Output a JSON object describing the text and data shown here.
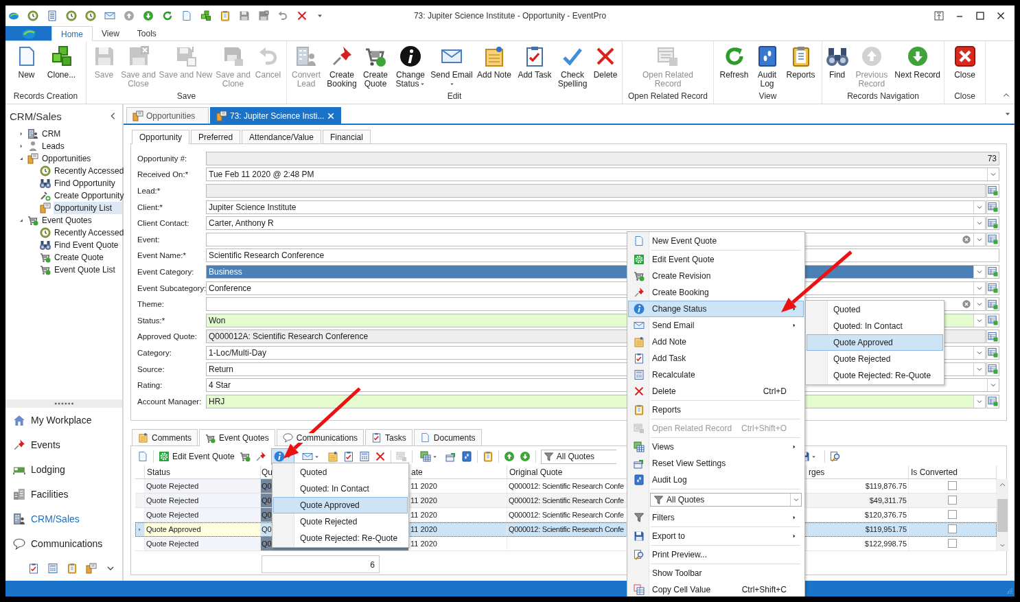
{
  "window": {
    "title": "73: Jupiter Science Institute - Opportunity - EventPro"
  },
  "ribbon": {
    "tabs": [
      {
        "label": "Home",
        "selected": true
      },
      {
        "label": "View",
        "selected": false
      },
      {
        "label": "Tools",
        "selected": false
      }
    ],
    "groups": [
      {
        "label": "Records Creation",
        "buttons": [
          {
            "label": "New",
            "disabled": false,
            "dropdown": false
          },
          {
            "label": "Clone...",
            "disabled": false,
            "dropdown": false
          }
        ]
      },
      {
        "label": "Save",
        "buttons": [
          {
            "label": "Save",
            "disabled": true,
            "dropdown": false
          },
          {
            "label": "Save and Close",
            "disabled": true,
            "dropdown": false
          },
          {
            "label": "Save and New",
            "disabled": true,
            "dropdown": false
          },
          {
            "label": "Save and Clone",
            "disabled": true,
            "dropdown": false
          },
          {
            "label": "Cancel",
            "disabled": true,
            "dropdown": false
          }
        ]
      },
      {
        "label": "Edit",
        "buttons": [
          {
            "label": "Convert Lead",
            "disabled": true,
            "dropdown": false
          },
          {
            "label": "Create Booking",
            "disabled": false,
            "dropdown": false
          },
          {
            "label": "Create Quote",
            "disabled": false,
            "dropdown": false
          },
          {
            "label": "Change Status",
            "disabled": false,
            "dropdown": true
          },
          {
            "label": "Send Email",
            "disabled": false,
            "dropdown": true
          },
          {
            "label": "Add Note",
            "disabled": false,
            "dropdown": false
          },
          {
            "label": "Add Task",
            "disabled": false,
            "dropdown": false
          },
          {
            "label": "Check Spelling",
            "disabled": false,
            "dropdown": false
          },
          {
            "label": "Delete",
            "disabled": false,
            "dropdown": false
          }
        ]
      },
      {
        "label": "Open Related Record",
        "buttons": [
          {
            "label": "Open Related Record",
            "disabled": true,
            "dropdown": false
          }
        ]
      },
      {
        "label": "View",
        "buttons": [
          {
            "label": "Refresh",
            "disabled": false,
            "dropdown": false
          },
          {
            "label": "Audit Log",
            "disabled": false,
            "dropdown": false
          },
          {
            "label": "Reports",
            "disabled": false,
            "dropdown": false
          }
        ]
      },
      {
        "label": "Records Navigation",
        "buttons": [
          {
            "label": "Find",
            "disabled": false,
            "dropdown": false
          },
          {
            "label": "Previous Record",
            "disabled": true,
            "dropdown": false
          },
          {
            "label": "Next Record",
            "disabled": false,
            "dropdown": false
          }
        ]
      },
      {
        "label": "Close",
        "buttons": [
          {
            "label": "Close",
            "disabled": false,
            "dropdown": false
          }
        ]
      }
    ]
  },
  "sidebar": {
    "title": "CRM/Sales",
    "tree": [
      {
        "label": "CRM",
        "expanded": false,
        "selected": false
      },
      {
        "label": "Leads",
        "expanded": false,
        "selected": false
      },
      {
        "label": "Opportunities",
        "expanded": true,
        "selected": false,
        "children": [
          {
            "label": "Recently Accessed",
            "selected": false
          },
          {
            "label": "Find Opportunity",
            "selected": false
          },
          {
            "label": "Create Opportunity",
            "selected": false
          },
          {
            "label": "Opportunity List",
            "selected": true
          }
        ]
      },
      {
        "label": "Event Quotes",
        "expanded": true,
        "selected": false,
        "children": [
          {
            "label": "Recently Accessed",
            "selected": false
          },
          {
            "label": "Find Event Quote",
            "selected": false
          },
          {
            "label": "Create Quote",
            "selected": false
          },
          {
            "label": "Event Quote List",
            "selected": false
          }
        ]
      }
    ],
    "nav": [
      {
        "label": "My Workplace",
        "selected": false
      },
      {
        "label": "Events",
        "selected": false
      },
      {
        "label": "Lodging",
        "selected": false
      },
      {
        "label": "Facilities",
        "selected": false
      },
      {
        "label": "CRM/Sales",
        "selected": true
      },
      {
        "label": "Communications",
        "selected": false
      }
    ]
  },
  "document_tabs": [
    {
      "label": "Opportunities",
      "selected": false,
      "closable": false
    },
    {
      "label": "73: Jupiter Science Insti...",
      "selected": true,
      "closable": true
    }
  ],
  "form": {
    "tabs": [
      {
        "label": "Opportunity",
        "selected": true
      },
      {
        "label": "Preferred",
        "selected": false
      },
      {
        "label": "Attendance/Value",
        "selected": false
      },
      {
        "label": "Financial",
        "selected": false
      }
    ],
    "fields": [
      {
        "label": "Opportunity #:",
        "value": "73",
        "kind": "number",
        "readonly": true
      },
      {
        "label": "Received On:*",
        "value": "Tue Feb 11 2020 @ 2:48 PM",
        "kind": "text",
        "dropdown": true
      },
      {
        "label": "Lead:*",
        "readonly": true,
        "lookup": true
      },
      {
        "label": "Client:*",
        "value": "Jupiter Science Institute",
        "kind": "text",
        "dropdown": true,
        "lookup": true
      },
      {
        "label": "Client Contact:",
        "value": "Carter, Anthony R",
        "kind": "text",
        "dropdown": true,
        "lookup": true
      },
      {
        "label": "Event:",
        "clear": true,
        "dropdown": true,
        "lookup": true
      },
      {
        "label": "Event Name:*",
        "value": "Scientific Research Conference",
        "kind": "text"
      },
      {
        "label": "Event Category:",
        "value": "Business",
        "kind": "text",
        "highlighted": true,
        "dropdown": true,
        "lookup": true
      },
      {
        "label": "Event Subcategory:",
        "value": "Conference",
        "kind": "text",
        "dropdown": true,
        "lookup": true
      },
      {
        "label": "Theme:",
        "clear": true,
        "dropdown": true,
        "lookup": true
      },
      {
        "label": "Status:*",
        "value": "Won",
        "kind": "text",
        "valid": true,
        "dropdown": true,
        "lookup": true
      },
      {
        "label": "Approved Quote:",
        "value": "Q000012A: Scientific Research Conference",
        "kind": "text",
        "readonly": true,
        "lookup": true
      },
      {
        "label": "Category:",
        "value": "1-Loc/Multi-Day",
        "kind": "text",
        "dropdown": true,
        "lookup": true
      },
      {
        "label": "Source:",
        "value": "Return",
        "kind": "text",
        "dropdown": true,
        "lookup": true
      },
      {
        "label": "Rating:",
        "value": "4 Star",
        "kind": "text",
        "dropdown": true
      },
      {
        "label": "Account Manager:",
        "value": "HRJ",
        "kind": "text",
        "valid": true,
        "dropdown": true,
        "lookup": true
      }
    ]
  },
  "details": {
    "tabs": [
      {
        "label": "Comments",
        "selected": false
      },
      {
        "label": "Event Quotes",
        "selected": true
      },
      {
        "label": "Communications",
        "selected": false
      },
      {
        "label": "Tasks",
        "selected": false
      },
      {
        "label": "Documents",
        "selected": false
      }
    ],
    "toolbar": {
      "edit_label": "Edit Event Quote",
      "filter": "All Quotes",
      "status_menu_open": true,
      "status_menu": [
        {
          "label": "Quoted",
          "selected": false
        },
        {
          "label": "Quoted: In Contact",
          "selected": false
        },
        {
          "label": "Quote Approved",
          "selected": true
        },
        {
          "label": "Quote Rejected",
          "selected": false
        },
        {
          "label": "Quote Rejected: Re-Quote",
          "selected": false
        }
      ]
    },
    "columns": [
      "Status",
      "Qu",
      "ate",
      "Original Quote",
      "rges",
      "Is Converted"
    ],
    "rows": [
      {
        "status": "Quote Rejected",
        "quote": "Q0",
        "date": "11 2020",
        "original_quote": "Q000012: Scientific Research Confe",
        "charges": "$119,876.75",
        "is_converted": false,
        "selected": false
      },
      {
        "status": "Quote Rejected",
        "quote": "Q0",
        "date": "11 2020",
        "original_quote": "Q000012: Scientific Research Confe",
        "charges": "$49,311.75",
        "is_converted": false,
        "selected": false
      },
      {
        "status": "Quote Rejected",
        "quote": "Q0",
        "date": "11 2020",
        "original_quote": "Q000012: Scientific Research Confe",
        "charges": "$120,376.75",
        "is_converted": false,
        "selected": false
      },
      {
        "status": "Quote Approved",
        "quote": "Q0",
        "date": "11 2020",
        "original_quote": "Q000012: Scientific Research Confe",
        "charges": "$119,951.75",
        "is_converted": false,
        "selected": true
      },
      {
        "status": "Quote Rejected",
        "quote": "Q0",
        "date": "11 2020",
        "charges": "$122,998.75",
        "is_converted": false,
        "selected": false
      }
    ],
    "summary": "6"
  },
  "context_menu": {
    "items": [
      {
        "kind": "item",
        "label": "New Event Quote",
        "selected": false
      },
      {
        "kind": "item",
        "label": "Edit Event Quote",
        "separator": true,
        "selected": false
      },
      {
        "kind": "item",
        "label": "Create Revision",
        "selected": false
      },
      {
        "kind": "item",
        "label": "Create Booking",
        "selected": false
      },
      {
        "kind": "item",
        "label": "Change Status",
        "submenu": true,
        "selected": true
      },
      {
        "kind": "item",
        "label": "Send Email",
        "submenu": true,
        "selected": false
      },
      {
        "kind": "item",
        "label": "Add Note",
        "selected": false
      },
      {
        "kind": "item",
        "label": "Add Task",
        "selected": false
      },
      {
        "kind": "item",
        "label": "Recalculate",
        "selected": false
      },
      {
        "kind": "item",
        "label": "Delete",
        "shortcut": "Ctrl+D",
        "selected": false
      },
      {
        "kind": "item",
        "label": "Reports",
        "separator": true,
        "selected": false
      },
      {
        "kind": "item",
        "label": "Open Related Record",
        "shortcut": "Ctrl+Shift+O",
        "separator": true,
        "disabled": true,
        "selected": false
      },
      {
        "kind": "item",
        "label": "Views",
        "separator": true,
        "submenu": true,
        "selected": false
      },
      {
        "kind": "item",
        "label": "Reset View Settings",
        "selected": false
      },
      {
        "kind": "item",
        "label": "Audit Log",
        "selected": false
      },
      {
        "kind": "combo",
        "label": "All Quotes",
        "separator": true
      },
      {
        "kind": "item",
        "label": "Filters",
        "submenu": true,
        "selected": false
      },
      {
        "kind": "item",
        "label": "Export to",
        "separator": true,
        "submenu": true,
        "selected": false
      },
      {
        "kind": "item",
        "label": "Print Preview...",
        "separator": true,
        "selected": false
      },
      {
        "kind": "item",
        "label": "Show Toolbar",
        "separator": true,
        "selected": false
      },
      {
        "kind": "item",
        "label": "Copy Cell Value",
        "shortcut": "Ctrl+Shift+C",
        "selected": false
      }
    ],
    "submenu": [
      {
        "label": "Quoted",
        "selected": false
      },
      {
        "label": "Quoted: In Contact",
        "selected": false
      },
      {
        "label": "Quote Approved",
        "selected": true
      },
      {
        "label": "Quote Rejected",
        "selected": false
      },
      {
        "label": "Quote Rejected: Re-Quote",
        "selected": false
      }
    ]
  }
}
